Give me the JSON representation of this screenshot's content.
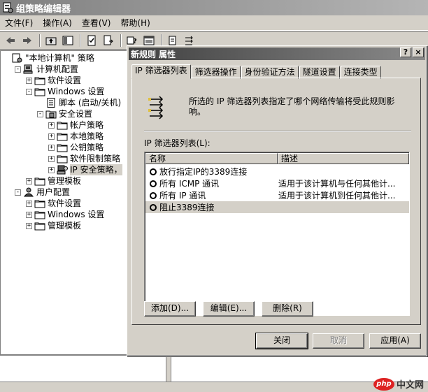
{
  "window": {
    "title": "组策略编辑器"
  },
  "menu": [
    "文件(F)",
    "操作(A)",
    "查看(V)",
    "帮助(H)"
  ],
  "toolbar_icons": [
    "back-icon",
    "forward-icon",
    "up-folder-icon",
    "show-tree-icon",
    "properties-icon",
    "export-icon",
    "help-icon",
    "console-icon",
    "new-policy-icon",
    "ipsec-tool-icon"
  ],
  "tree": [
    {
      "label": "\"本地计算机\" 策略",
      "level": 0,
      "exp": "",
      "icon": "policy"
    },
    {
      "label": "计算机配置",
      "level": 1,
      "exp": "-",
      "icon": "computer"
    },
    {
      "label": "软件设置",
      "level": 2,
      "exp": "+",
      "icon": "folder"
    },
    {
      "label": "Windows 设置",
      "level": 2,
      "exp": "-",
      "icon": "folder"
    },
    {
      "label": "脚本 (启动/关机)",
      "level": 3,
      "exp": "",
      "icon": "script"
    },
    {
      "label": "安全设置",
      "level": 3,
      "exp": "-",
      "icon": "security"
    },
    {
      "label": "帐户策略",
      "level": 4,
      "exp": "+",
      "icon": "folder"
    },
    {
      "label": "本地策略",
      "level": 4,
      "exp": "+",
      "icon": "folder"
    },
    {
      "label": "公钥策略",
      "level": 4,
      "exp": "+",
      "icon": "folder"
    },
    {
      "label": "软件限制策略",
      "level": 4,
      "exp": "+",
      "icon": "folder"
    },
    {
      "label": "IP 安全策略，",
      "level": 4,
      "exp": "+",
      "icon": "ipsec",
      "selected": true
    },
    {
      "label": "管理模板",
      "level": 2,
      "exp": "+",
      "icon": "folder"
    },
    {
      "label": "用户配置",
      "level": 1,
      "exp": "-",
      "icon": "user"
    },
    {
      "label": "软件设置",
      "level": 2,
      "exp": "+",
      "icon": "folder"
    },
    {
      "label": "Windows 设置",
      "level": 2,
      "exp": "+",
      "icon": "folder"
    },
    {
      "label": "管理模板",
      "level": 2,
      "exp": "+",
      "icon": "folder"
    }
  ],
  "dialog": {
    "title": "新规则 属性",
    "help_btn": "?",
    "close_btn": "×",
    "tabs": [
      "IP 筛选器列表",
      "筛选器操作",
      "身份验证方法",
      "隧道设置",
      "连接类型"
    ],
    "description": "所选的 IP 筛选器列表指定了哪个网络传输将受此规则影响。",
    "list_label": "IP 筛选器列表(L):",
    "columns": [
      "名称",
      "描述"
    ],
    "rows": [
      {
        "name": "放行指定IP的3389连接",
        "desc": "",
        "selected": false
      },
      {
        "name": "所有 ICMP 通讯",
        "desc": "适用于该计算机与任何其他计...",
        "selected": false
      },
      {
        "name": "所有 IP 通讯",
        "desc": "适用于该计算机到任何其他计...",
        "selected": false
      },
      {
        "name": "阻止3389连接",
        "desc": "",
        "selected": true
      }
    ],
    "buttons": {
      "add": "添加(D)...",
      "edit": "编辑(E)...",
      "remove": "删除(R)"
    },
    "footer": {
      "close": "关闭",
      "cancel": "取消",
      "apply": "应用(A)"
    }
  },
  "watermark": {
    "logo": "php",
    "text": "中文网"
  }
}
